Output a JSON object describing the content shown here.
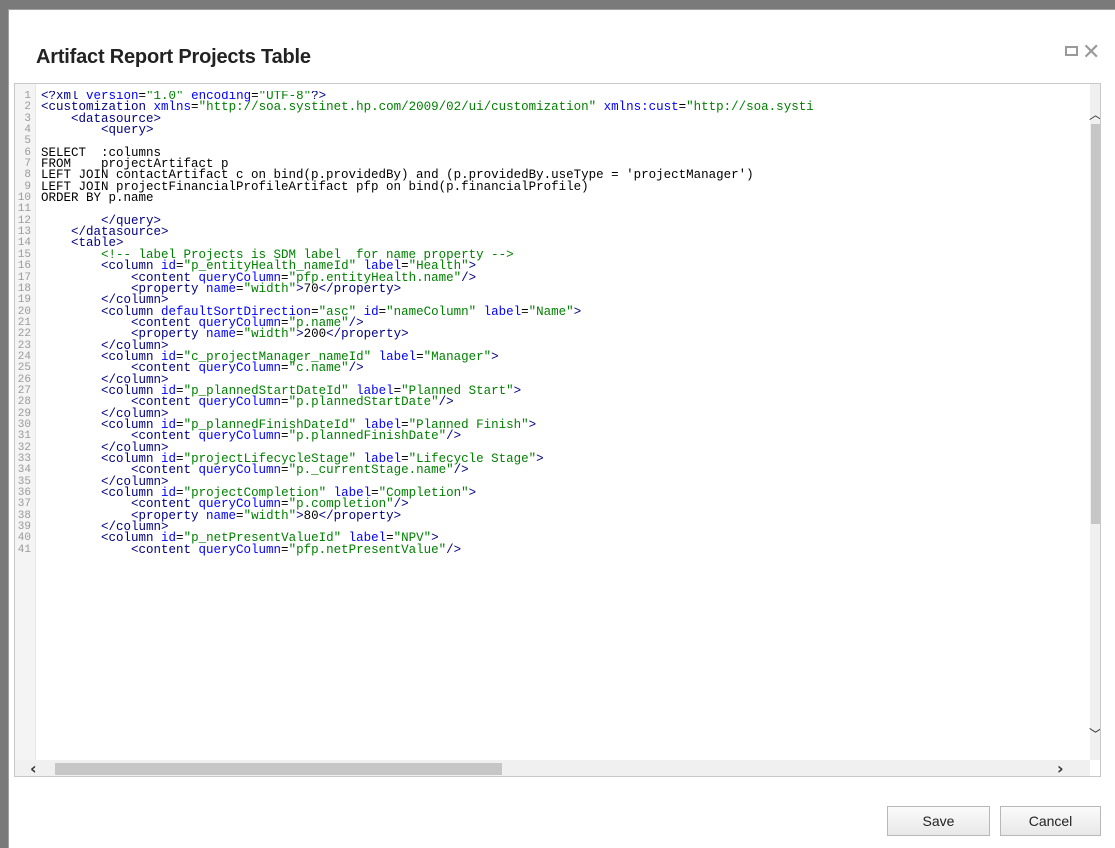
{
  "dialog": {
    "title": "Artifact Report Projects Table",
    "buttons": {
      "save": "Save",
      "cancel": "Cancel"
    }
  },
  "icons": {
    "maximize": "maximize-icon",
    "close": "close-icon"
  },
  "editor": {
    "lines": [
      {
        "n": "1",
        "t": "<?xml version=\"1.0\" encoding=\"UTF-8\"?>"
      },
      {
        "n": "2",
        "t": "<customization xmlns=\"http://soa.systinet.hp.com/2009/02/ui/customization\" xmlns:cust=\"http://soa.systi"
      },
      {
        "n": "3",
        "t": "    <datasource>"
      },
      {
        "n": "4",
        "t": "        <query>"
      },
      {
        "n": "5",
        "t": ""
      },
      {
        "n": "6",
        "t": "SELECT  :columns"
      },
      {
        "n": "7",
        "t": "FROM    projectArtifact p"
      },
      {
        "n": "8",
        "t": "LEFT JOIN contactArtifact c on bind(p.providedBy) and (p.providedBy.useType = 'projectManager')"
      },
      {
        "n": "9",
        "t": "LEFT JOIN projectFinancialProfileArtifact pfp on bind(p.financialProfile)"
      },
      {
        "n": "10",
        "t": "ORDER BY p.name"
      },
      {
        "n": "11",
        "t": ""
      },
      {
        "n": "12",
        "t": "        </query>"
      },
      {
        "n": "13",
        "t": "    </datasource>"
      },
      {
        "n": "14",
        "t": "    <table>"
      },
      {
        "n": "15",
        "t": "        <!-- label Projects is SDM label  for name property -->"
      },
      {
        "n": "16",
        "t": "        <column id=\"p_entityHealth_nameId\" label=\"Health\">"
      },
      {
        "n": "17",
        "t": "            <content queryColumn=\"pfp.entityHealth.name\"/>"
      },
      {
        "n": "18",
        "t": "            <property name=\"width\">70</property>"
      },
      {
        "n": "19",
        "t": "        </column>"
      },
      {
        "n": "20",
        "t": "        <column defaultSortDirection=\"asc\" id=\"nameColumn\" label=\"Name\">"
      },
      {
        "n": "21",
        "t": "            <content queryColumn=\"p.name\"/>"
      },
      {
        "n": "22",
        "t": "            <property name=\"width\">200</property>"
      },
      {
        "n": "23",
        "t": "        </column>"
      },
      {
        "n": "24",
        "t": "        <column id=\"c_projectManager_nameId\" label=\"Manager\">"
      },
      {
        "n": "25",
        "t": "            <content queryColumn=\"c.name\"/>"
      },
      {
        "n": "26",
        "t": "        </column>"
      },
      {
        "n": "27",
        "t": "        <column id=\"p_plannedStartDateId\" label=\"Planned Start\">"
      },
      {
        "n": "28",
        "t": "            <content queryColumn=\"p.plannedStartDate\"/>"
      },
      {
        "n": "29",
        "t": "        </column>"
      },
      {
        "n": "30",
        "t": "        <column id=\"p_plannedFinishDateId\" label=\"Planned Finish\">"
      },
      {
        "n": "31",
        "t": "            <content queryColumn=\"p.plannedFinishDate\"/>"
      },
      {
        "n": "32",
        "t": "        </column>"
      },
      {
        "n": "33",
        "t": "        <column id=\"projectLifecycleStage\" label=\"Lifecycle Stage\">"
      },
      {
        "n": "34",
        "t": "            <content queryColumn=\"p._currentStage.name\"/>"
      },
      {
        "n": "35",
        "t": "        </column>"
      },
      {
        "n": "36",
        "t": "        <column id=\"projectCompletion\" label=\"Completion\">"
      },
      {
        "n": "37",
        "t": "            <content queryColumn=\"p.completion\"/>"
      },
      {
        "n": "38",
        "t": "            <property name=\"width\">80</property>"
      },
      {
        "n": "39",
        "t": "        </column>"
      },
      {
        "n": "40",
        "t": "        <column id=\"p_netPresentValueId\" label=\"NPV\">"
      },
      {
        "n": "41",
        "t": "            <content queryColumn=\"pfp.netPresentValue\"/>"
      }
    ]
  },
  "scrollbars": {
    "up": "up-arrow-icon",
    "down": "down-arrow-icon",
    "left": "left-arrow-icon",
    "right": "right-arrow-icon"
  },
  "colors": {
    "tag": "#000080",
    "attr": "#0000ff",
    "value": "#008000",
    "comment": "#008000"
  }
}
